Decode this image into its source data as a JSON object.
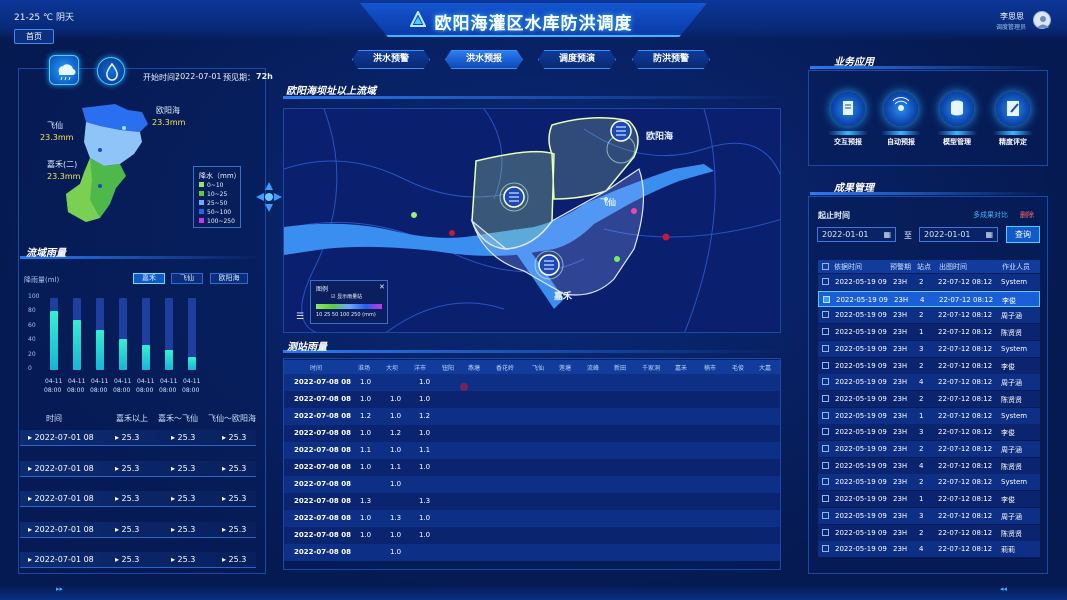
{
  "header": {
    "title": "欧阳海灌区水库防洪调度",
    "weather": "21-25 ℃ 阴天",
    "user_name": "李思思",
    "user_role": "调度管理员",
    "home": "首页"
  },
  "tabs": [
    "洪水预警",
    "洪水预报",
    "调度预演",
    "防洪预警"
  ],
  "left": {
    "start_label": "开始时间：",
    "start_time": "2022-07-01",
    "forecast_label": "预见期：",
    "forecast_period": "72h",
    "map_labels": [
      {
        "name": "欧阳海",
        "value": "23.3mm"
      },
      {
        "name": "飞仙",
        "value": "23.3mm"
      },
      {
        "name": "嘉禾(二)",
        "value": "23.3mm"
      }
    ],
    "legend_title": "降水（mm）",
    "legend": [
      {
        "label": "0~10",
        "color": "#8fe86a"
      },
      {
        "label": "10~25",
        "color": "#5acd3c"
      },
      {
        "label": "25~50",
        "color": "#6fa8ff"
      },
      {
        "label": "50~100",
        "color": "#2a5fe8"
      },
      {
        "label": "100~250",
        "color": "#c23ae8"
      }
    ],
    "rain_title": "流域雨量",
    "rain_unit": "降雨量(ml)",
    "range_buttons": [
      "嘉禾",
      "飞仙",
      "欧阳海"
    ],
    "chart_yticks": [
      "0",
      "20",
      "40",
      "60",
      "80",
      "100"
    ],
    "chart_data": {
      "type": "bar",
      "categories": [
        "04-11 08:00",
        "04-11 08:00",
        "04-11 08:00",
        "04-11 08:00",
        "04-11 08:00",
        "04-11 08:00",
        "04-11 08:00"
      ],
      "values": [
        82,
        70,
        55,
        43,
        35,
        28,
        18
      ],
      "ylim": [
        0,
        100
      ],
      "ylabel": "降雨量(ml)"
    },
    "history_headers": [
      "时间",
      "嘉禾以上",
      "嘉禾～飞仙",
      "飞仙～欧阳海"
    ],
    "history_rows": [
      [
        "2022-07-01  08",
        "25.3",
        "25.3",
        "25.3"
      ],
      [
        "2022-07-01  08",
        "25.3",
        "25.3",
        "25.3"
      ],
      [
        "2022-07-01  08",
        "25.3",
        "25.3",
        "25.3"
      ],
      [
        "2022-07-01  08",
        "25.3",
        "25.3",
        "25.3"
      ],
      [
        "2022-07-01  08",
        "25.3",
        "25.3",
        "25.3"
      ]
    ]
  },
  "center": {
    "map_title": "欧阳海坝址以上流域",
    "map_labels": [
      "欧阳海",
      "飞仙",
      "嘉禾"
    ],
    "map_legend_title": "图例",
    "map_legend_check": "显示雨量站",
    "map_legend_scale": "10  25  50 100  250  (mm)",
    "station_title": "测站雨量",
    "station_headers": [
      "时间",
      "淮场",
      "大坝",
      "洋市",
      "钮阳",
      "燕塘",
      "香花岭",
      "飞仙",
      "莲塘",
      "流峰",
      "新田",
      "千家洞",
      "嘉禾",
      "楠市",
      "毛俊",
      "大嘉"
    ],
    "station_rows": [
      [
        "2022-07-08  08",
        "1.0",
        "",
        "1.0"
      ],
      [
        "2022-07-08  08",
        "1.0",
        "1.0",
        "1.0"
      ],
      [
        "2022-07-08  08",
        "1.2",
        "1.0",
        "1.2"
      ],
      [
        "2022-07-08  08",
        "1.0",
        "1.2",
        "1.0"
      ],
      [
        "2022-07-08  08",
        "1.1",
        "1.0",
        "1.1"
      ],
      [
        "2022-07-08  08",
        "1.0",
        "1.1",
        "1.0"
      ],
      [
        "2022-07-08  08",
        "",
        "1.0",
        ""
      ],
      [
        "2022-07-08  08",
        "1.3",
        "",
        "1.3"
      ],
      [
        "2022-07-08  08",
        "1.0",
        "1.3",
        "1.0"
      ],
      [
        "2022-07-08  08",
        "1.0",
        "1.0",
        "1.0"
      ],
      [
        "2022-07-08  08",
        "",
        "1.0",
        ""
      ]
    ]
  },
  "right": {
    "apps_title": "业务应用",
    "apps": [
      "交互预报",
      "自动预报",
      "模型管理",
      "精度评定"
    ],
    "results_title": "成果管理",
    "time_label": "起止时间",
    "multi_compare": "多成果对比",
    "delete": "删除",
    "date_from": "2022-01-01",
    "to": "至",
    "date_to": "2022-01-01",
    "query": "查询",
    "result_headers": [
      "依据时间",
      "预警期",
      "站点",
      "出图时间",
      "作业人员"
    ],
    "result_rows": [
      [
        "2022-05-19 09",
        "23H",
        "2",
        "22-07-12 08:12",
        "System"
      ],
      [
        "2022-05-19 09",
        "23H",
        "4",
        "22-07-12 08:12",
        "李俊"
      ],
      [
        "2022-05-19 09",
        "23H",
        "2",
        "22-07-12 08:12",
        "周子涵"
      ],
      [
        "2022-05-19 09",
        "23H",
        "1",
        "22-07-12 08:12",
        "陈贤贤"
      ],
      [
        "2022-05-19 09",
        "23H",
        "3",
        "22-07-12 08:12",
        "System"
      ],
      [
        "2022-05-19 09",
        "23H",
        "2",
        "22-07-12 08:12",
        "李俊"
      ],
      [
        "2022-05-19 09",
        "23H",
        "4",
        "22-07-12 08:12",
        "周子涵"
      ],
      [
        "2022-05-19 09",
        "23H",
        "2",
        "22-07-12 08:12",
        "陈贤贤"
      ],
      [
        "2022-05-19 09",
        "23H",
        "1",
        "22-07-12 08:12",
        "System"
      ],
      [
        "2022-05-19 09",
        "23H",
        "3",
        "22-07-12 08:12",
        "李俊"
      ],
      [
        "2022-05-19 09",
        "23H",
        "2",
        "22-07-12 08:12",
        "周子涵"
      ],
      [
        "2022-05-19 09",
        "23H",
        "4",
        "22-07-12 08:12",
        "陈贤贤"
      ],
      [
        "2022-05-19 09",
        "23H",
        "2",
        "22-07-12 08:12",
        "System"
      ],
      [
        "2022-05-19 09",
        "23H",
        "1",
        "22-07-12 08:12",
        "李俊"
      ],
      [
        "2022-05-19 09",
        "23H",
        "3",
        "22-07-12 08:12",
        "周子涵"
      ],
      [
        "2022-05-19 09",
        "23H",
        "2",
        "22-07-12 08:12",
        "陈贤贤"
      ],
      [
        "2022-05-19 09",
        "23H",
        "4",
        "22-07-12 08:12",
        "莉莉"
      ]
    ]
  }
}
